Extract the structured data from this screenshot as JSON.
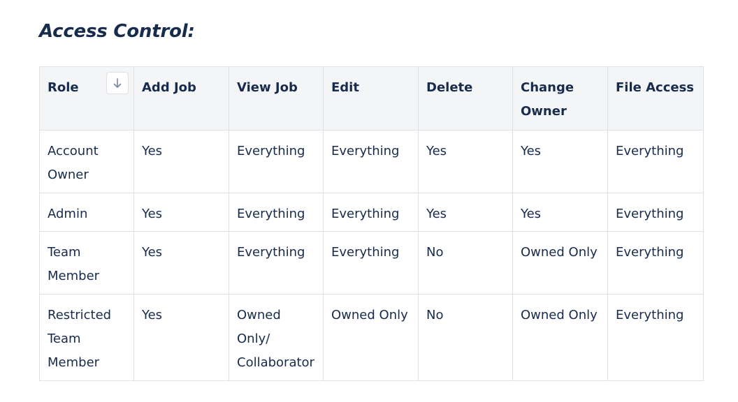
{
  "heading": "Access Control:",
  "table": {
    "headers": [
      "Role",
      "Add Job",
      "View Job",
      "Edit",
      "Delete",
      "Change Owner",
      "File Access"
    ],
    "sort_icon": "arrow-down-icon",
    "rows": [
      [
        "Account Owner",
        "Yes",
        "Everything",
        "Everything",
        "Yes",
        "Yes",
        "Everything"
      ],
      [
        "Admin",
        "Yes",
        "Everything",
        "Everything",
        "Yes",
        "Yes",
        "Everything"
      ],
      [
        "Team Member",
        "Yes",
        "Everything",
        "Everything",
        "No",
        "Owned Only",
        "Everything"
      ],
      [
        "Restricted Team Member",
        "Yes",
        "Owned Only/ Collaborator",
        "Owned Only",
        "No",
        "Owned Only",
        "Everything"
      ]
    ]
  },
  "colors": {
    "text": "#172b4d",
    "header_bg": "#f4f5f7",
    "border": "#dfe1e6"
  }
}
